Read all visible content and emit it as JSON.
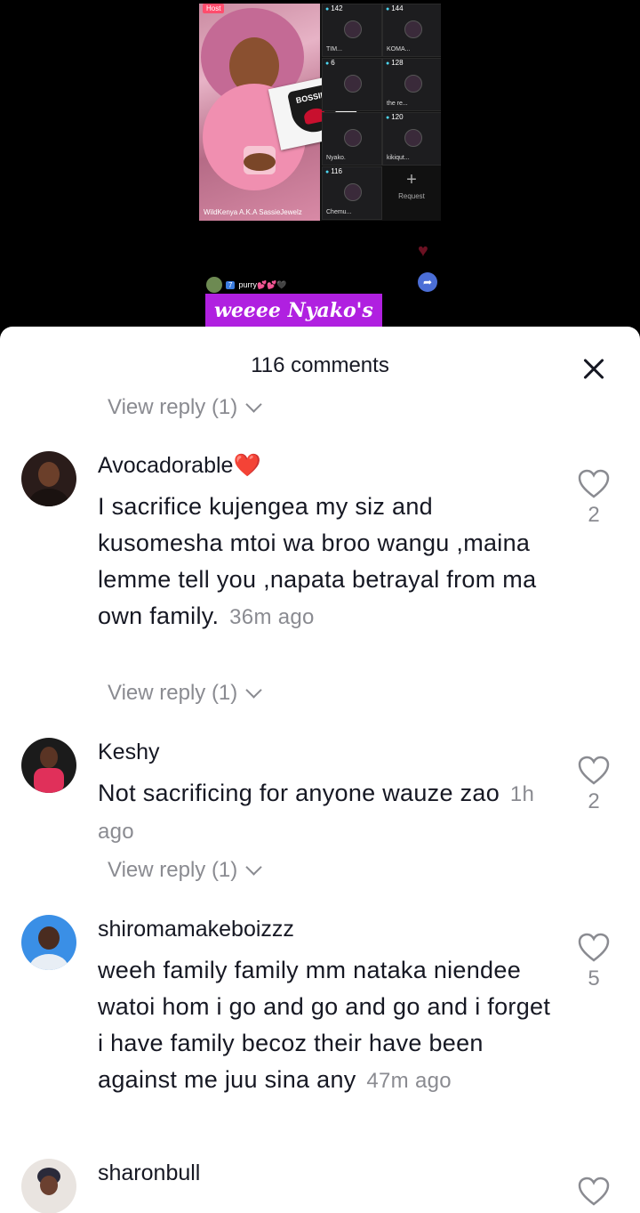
{
  "live_preview": {
    "host_badge": "Host",
    "host_name": "WildKenya A.K.A SassieJewelz",
    "card_text": "BOSSIE",
    "guests": [
      {
        "count": "142",
        "name": "TIM..."
      },
      {
        "count": "144",
        "name": "KOMA..."
      },
      {
        "count": "6",
        "name": ""
      },
      {
        "count": "128",
        "name": "the re..."
      },
      {
        "count": "",
        "name": "Nyako."
      },
      {
        "count": "120",
        "name": "kikiqut..."
      },
      {
        "count": "116",
        "name": "Chemu..."
      }
    ],
    "request_label": "Request",
    "viewer_level": "7",
    "viewer_name": "purry💕💕🖤",
    "caption": "weeee Nyako's"
  },
  "sheet": {
    "title": "116 comments",
    "view_reply_label": "View reply (1)"
  },
  "comments": [
    {
      "username": "Avocadorable",
      "username_emoji": "❤️",
      "text": "I sacrifice kujengea my siz and kusomesha mtoi wa broo wangu ,maina lemme tell you ,napata betrayal from ma own family.",
      "time": "36m ago",
      "likes": "2"
    },
    {
      "username": "Keshy",
      "text": "Not sacrificing for anyone wauze zao",
      "time": "1h ago",
      "likes": "2"
    },
    {
      "username": "shiromamakeboizzz",
      "text": "weeh family family mm nataka niendee watoi hom i go and go and go and i forget i have family becoz their have been against me juu sina any",
      "time": "47m ago",
      "likes": "5"
    },
    {
      "username": "sharonbull",
      "text": "",
      "time": "",
      "likes": ""
    }
  ],
  "colors": {
    "caption_bg": "#b020e0",
    "muted_text": "#8a8b91",
    "primary_text": "#161823"
  }
}
